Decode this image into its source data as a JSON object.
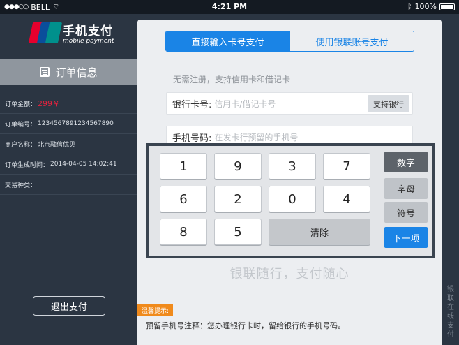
{
  "status": {
    "carrier": "BELL",
    "time": "4:21 PM",
    "battery": "100%"
  },
  "brand": {
    "logo_text": "UnionPay 银联",
    "title": "手机支付",
    "subtitle": "mobile payment"
  },
  "order": {
    "header": "订单信息",
    "rows": [
      {
        "label": "订单金额：",
        "value": "299￥"
      },
      {
        "label": "订单编号：",
        "value": "1234567891234567890"
      },
      {
        "label": "商户名称：",
        "value": "北京融信优贝"
      },
      {
        "label": "订单生成时间：",
        "value": "2014-04-05 14:02:41"
      },
      {
        "label": "交易种类：",
        "value": ""
      }
    ]
  },
  "exit_label": "退出支付",
  "tabs": {
    "active": "直接输入卡号支付",
    "inactive": "使用银联账号支付"
  },
  "form": {
    "hint": "无需注册，支持信用卡和借记卡",
    "card_label": "银行卡号:",
    "card_placeholder": "信用卡/借记卡号",
    "bank_button": "支持银行",
    "phone_label": "手机号码:",
    "phone_placeholder": "在发卡行预留的手机号"
  },
  "keypad": {
    "keys": [
      "1",
      "9",
      "3",
      "7",
      "6",
      "2",
      "0",
      "4",
      "8",
      "5"
    ],
    "clear": "清除",
    "modes": [
      "数字",
      "字母",
      "符号"
    ],
    "next": "下一项"
  },
  "slogan": "银联随行，支付随心",
  "tip": {
    "badge": "温馨提示:",
    "text": "预留手机号注释：您办理银行卡时，留给银行的手机号码。"
  },
  "vertical_text": "银联在线支付",
  "colors": {
    "accent": "#1a84e6",
    "sidebar": "#2b3542",
    "price": "#e2223e",
    "tip": "#f08a1c"
  }
}
